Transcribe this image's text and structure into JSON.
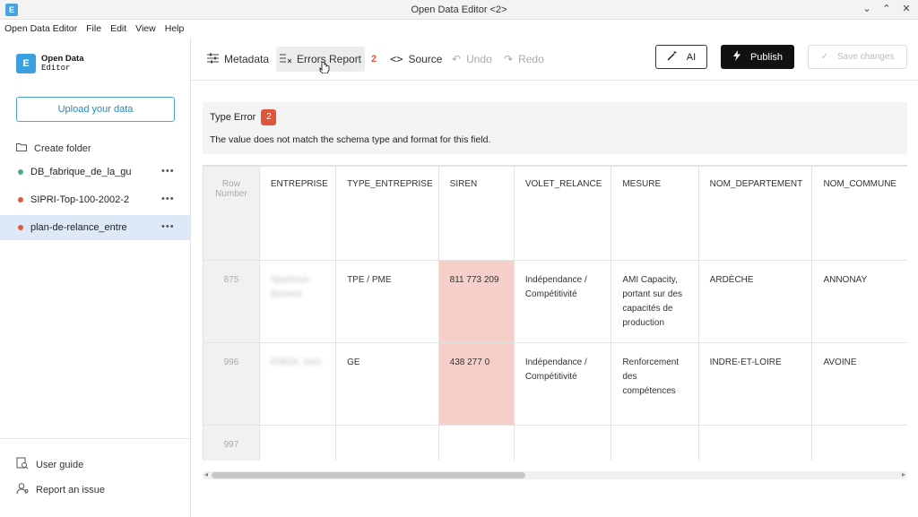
{
  "window": {
    "title": "Open Data Editor <2>",
    "controls": [
      "⌄",
      "⌃",
      "✕"
    ]
  },
  "menu": [
    "Open Data Editor",
    "File",
    "Edit",
    "View",
    "Help"
  ],
  "sidebar": {
    "logo_line1": "Open Data",
    "logo_line2": "Editor",
    "upload_label": "Upload your data",
    "create_folder_label": "Create folder",
    "files": [
      {
        "name": "DB_fabrique_de_la_gu",
        "color": "#4caf7d"
      },
      {
        "name": "SIPRI-Top-100-2002-2",
        "color": "#e05a3f"
      },
      {
        "name": "plan-de-relance_entre",
        "color": "#e05a3f"
      }
    ],
    "more": "•••",
    "user_guide": "User guide",
    "report_issue": "Report an issue"
  },
  "toolbar": {
    "metadata": "Metadata",
    "errors_report": "Errors Report",
    "errors_count": "2",
    "source": "Source",
    "undo": "Undo",
    "redo": "Redo",
    "ai": "AI",
    "publish": "Publish",
    "save": "Save changes"
  },
  "error_panel": {
    "title": "Type Error",
    "count": "2",
    "description": "The value does not match the schema type and format for this field."
  },
  "table": {
    "row_number_header": "Row Number",
    "columns": [
      "ENTREPRISE",
      "TYPE_ENTREPRISE",
      "SIREN",
      "VOLET_RELANCE",
      "MESURE",
      "NOM_DEPARTEMENT",
      "NOM_COMMUNE"
    ],
    "rows": [
      {
        "num": "875",
        "cells": [
          "Sporticus-Biomed",
          "TPE / PME",
          "811 773 209",
          "Indépendance / Compétitivité",
          "AMI Capacity, portant sur des capacités de production",
          "ARDÈCHE",
          "ANNONAY"
        ]
      },
      {
        "num": "996",
        "cells": [
          "ENEDI, SAS",
          "GE",
          "438 277 0",
          "Indépendance / Compétitivité",
          "Renforcement des compétences",
          "INDRE-ET-LOIRE",
          "AVOINE"
        ]
      },
      {
        "num": "997",
        "cells": [
          "",
          "",
          "",
          "",
          "",
          "",
          ""
        ]
      }
    ]
  },
  "colors": {
    "accent": "#3aa0e0",
    "error": "#e0563c",
    "error_cell": "#f6cfc8"
  }
}
